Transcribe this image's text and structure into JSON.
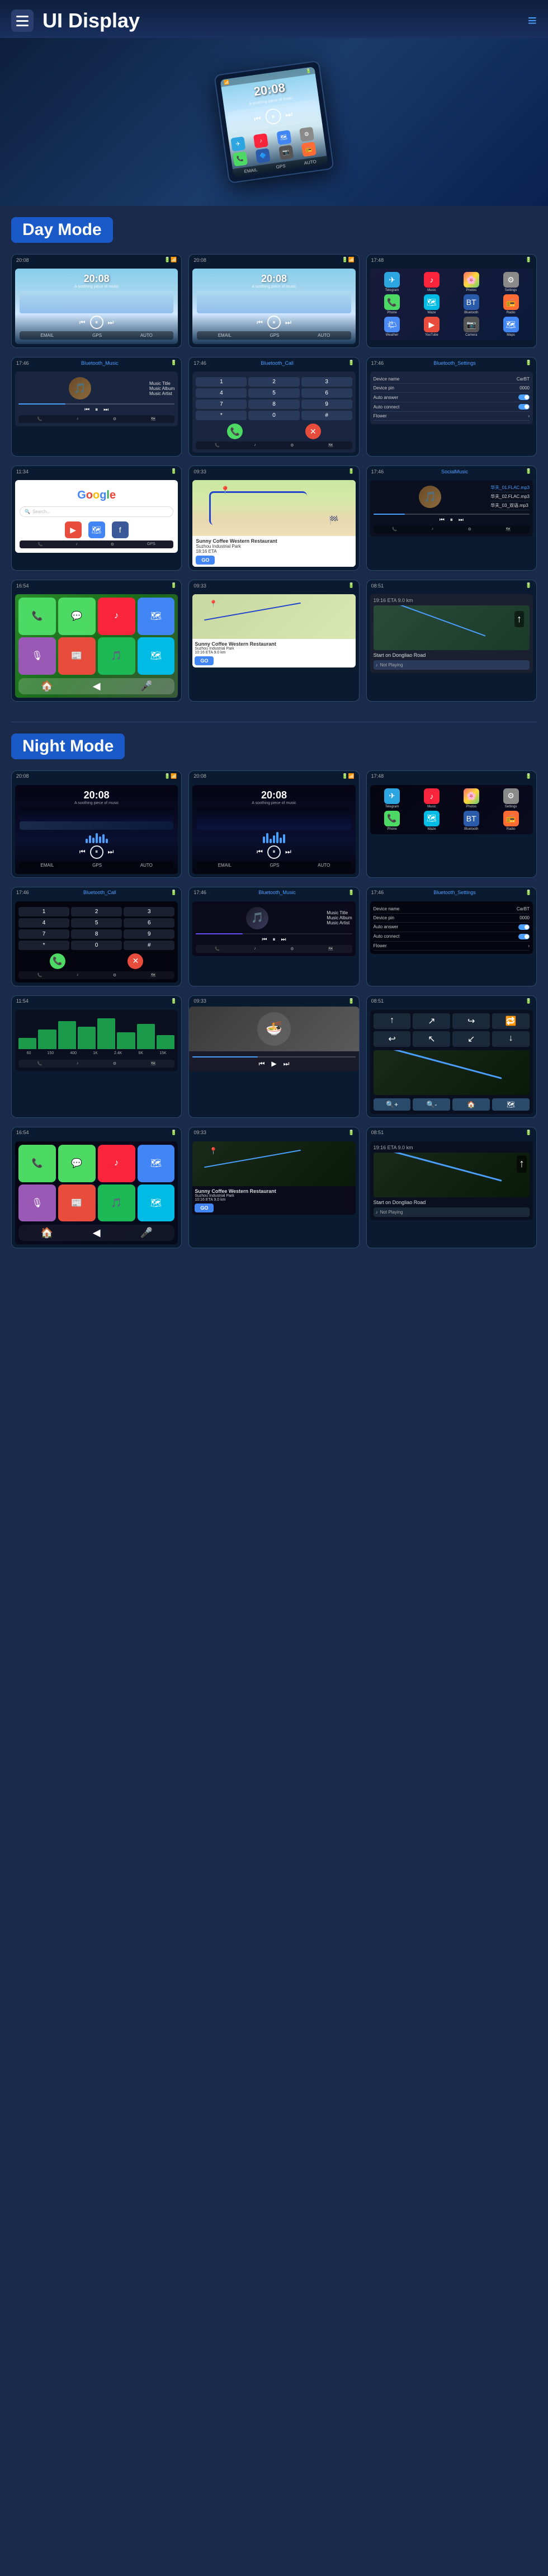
{
  "header": {
    "title": "UI Display",
    "menu_icon": "☰",
    "nav_icon": "≡"
  },
  "hero": {
    "time": "20:08",
    "subtitle": "A soothing piece of music"
  },
  "day_mode": {
    "label": "Day Mode",
    "screens": [
      {
        "type": "player",
        "time": "20:08",
        "subtitle": "A soothing piece of music"
      },
      {
        "type": "player2",
        "time": "20:08",
        "subtitle": "A soothing piece of music"
      },
      {
        "type": "apps"
      }
    ],
    "row2": [
      {
        "type": "music",
        "title": "Music Title",
        "album": "Music Album",
        "artist": "Music Artist"
      },
      {
        "type": "call"
      },
      {
        "type": "settings"
      }
    ],
    "row3": [
      {
        "type": "google"
      },
      {
        "type": "map"
      },
      {
        "type": "social_music"
      }
    ],
    "row4": [
      {
        "type": "ios"
      },
      {
        "type": "coffee"
      },
      {
        "type": "nav_screen"
      }
    ]
  },
  "night_mode": {
    "label": "Night Mode",
    "screens": [
      {
        "type": "night_player",
        "time": "20:08"
      },
      {
        "type": "night_player2",
        "time": "20:08"
      },
      {
        "type": "night_apps"
      }
    ],
    "row2": [
      {
        "type": "night_call"
      },
      {
        "type": "night_music",
        "title": "Music Title",
        "album": "Music Album",
        "artist": "Music Artist"
      },
      {
        "type": "night_settings"
      }
    ],
    "row3": [
      {
        "type": "equalizer"
      },
      {
        "type": "media_player"
      },
      {
        "type": "night_nav"
      }
    ],
    "row4": [
      {
        "type": "night_ios"
      },
      {
        "type": "night_coffee"
      },
      {
        "type": "night_nav2"
      }
    ]
  },
  "player": {
    "music_title": "Music Title",
    "music_album": "Music Album",
    "music_artist": "Music Artist"
  },
  "track_list": [
    {
      "name": "华夫_01.FLAC.mp3",
      "active": true
    },
    {
      "name": "华夫_02.FLAC.mp3",
      "active": false
    },
    {
      "name": "华夫_03_双语_Dragon Road",
      "active": false
    }
  ],
  "coffee_shop": {
    "name": "Sunny Coffee Western Restaurant",
    "address": "Suzhou Industrial Park",
    "eta": "10:16 ETA  9.0 km",
    "go_label": "GO"
  },
  "settings": {
    "device_name_label": "Device name",
    "device_name_value": "CarBT",
    "device_pin_label": "Device pin",
    "device_pin_value": "0000",
    "auto_answer_label": "Auto answer",
    "auto_connect_label": "Auto connect",
    "flower_label": "Flower"
  },
  "nav": {
    "distance": "19:16 ETA  9.0 km",
    "instruction": "Start on Dongliao Road",
    "not_playing": "Not Playing"
  }
}
